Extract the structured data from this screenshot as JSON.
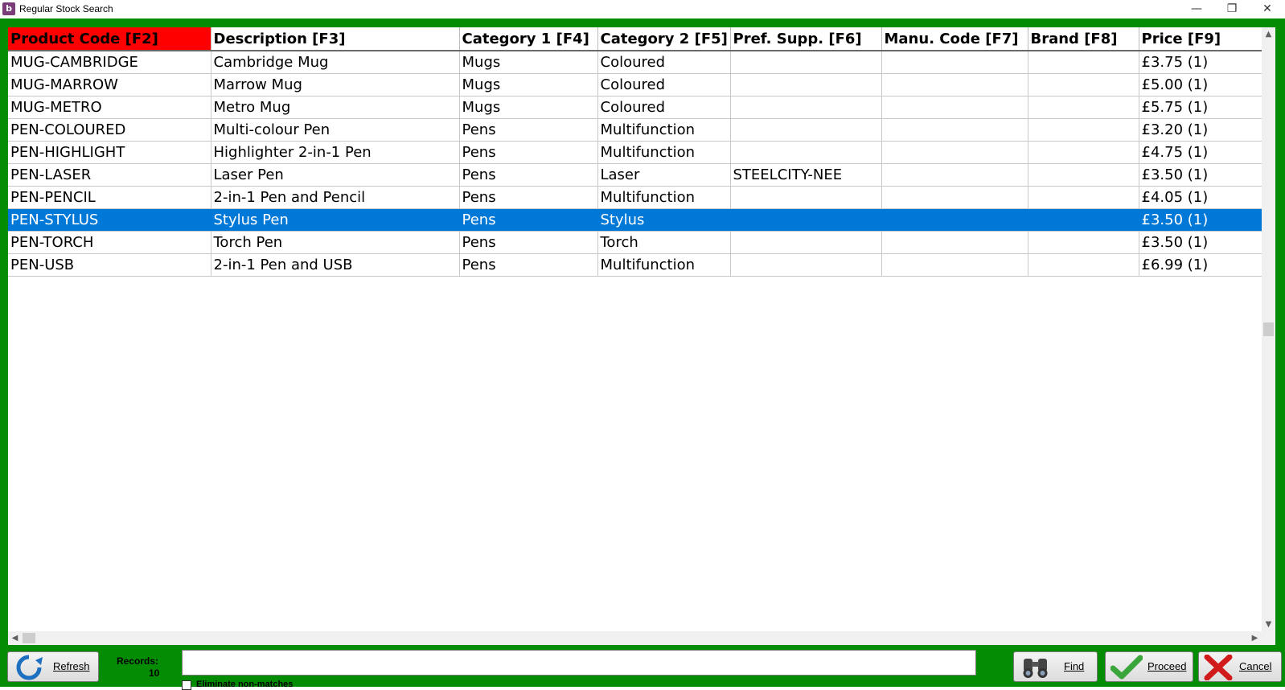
{
  "window": {
    "title": "Regular Stock Search",
    "icon_glyph": "b",
    "minimize_glyph": "—",
    "restore_glyph": "❐",
    "close_glyph": "✕"
  },
  "grid": {
    "columns": [
      "Product Code [F2]",
      "Description [F3]",
      "Category 1 [F4]",
      "Category 2 [F5]",
      "Pref. Supp. [F6]",
      "Manu. Code [F7]",
      "Brand [F8]",
      "Price [F9]"
    ],
    "sorted_column_color": "#ff0000",
    "selection_color": "#0078d7",
    "rows": [
      [
        "MUG-CAMBRIDGE",
        "Cambridge Mug",
        "Mugs",
        "Coloured",
        "",
        "",
        "",
        "£3.75 (1)"
      ],
      [
        "MUG-MARROW",
        "Marrow Mug",
        "Mugs",
        "Coloured",
        "",
        "",
        "",
        "£5.00 (1)"
      ],
      [
        "MUG-METRO",
        "Metro Mug",
        "Mugs",
        "Coloured",
        "",
        "",
        "",
        "£5.75 (1)"
      ],
      [
        "PEN-COLOURED",
        "Multi-colour Pen",
        "Pens",
        "Multifunction",
        "",
        "",
        "",
        "£3.20 (1)"
      ],
      [
        "PEN-HIGHLIGHT",
        "Highlighter 2-in-1 Pen",
        "Pens",
        "Multifunction",
        "",
        "",
        "",
        "£4.75 (1)"
      ],
      [
        "PEN-LASER",
        "Laser Pen",
        "Pens",
        "Laser",
        "STEELCITY-NEE",
        "",
        "",
        "£3.50 (1)"
      ],
      [
        "PEN-PENCIL",
        "2-in-1 Pen and Pencil",
        "Pens",
        "Multifunction",
        "",
        "",
        "",
        "£4.05 (1)"
      ],
      [
        "PEN-STYLUS",
        "Stylus Pen",
        "Pens",
        "Stylus",
        "",
        "",
        "",
        "£3.50 (1)"
      ],
      [
        "PEN-TORCH",
        "Torch Pen",
        "Pens",
        "Torch",
        "",
        "",
        "",
        "£3.50 (1)"
      ],
      [
        "PEN-USB",
        "2-in-1 Pen and USB",
        "Pens",
        "Multifunction",
        "",
        "",
        "",
        "£6.99 (1)"
      ]
    ],
    "selected_row": 7
  },
  "scrollbars": {
    "up_arrow": "▲",
    "down_arrow": "▼",
    "left_arrow": "◀",
    "right_arrow": "▶"
  },
  "footer": {
    "refresh_label": "Refresh",
    "records_label": "Records:",
    "records_count": "10",
    "search_value": "",
    "eliminate_label": "Eliminate non-matches",
    "find_label": "Find",
    "proceed_label": "Proceed",
    "cancel_label": "Cancel"
  },
  "colors": {
    "frame": "#058c05",
    "proceed_check": "#3aa53a",
    "cancel_x": "#d11a1a",
    "refresh_icon": "#1e6fc0"
  }
}
